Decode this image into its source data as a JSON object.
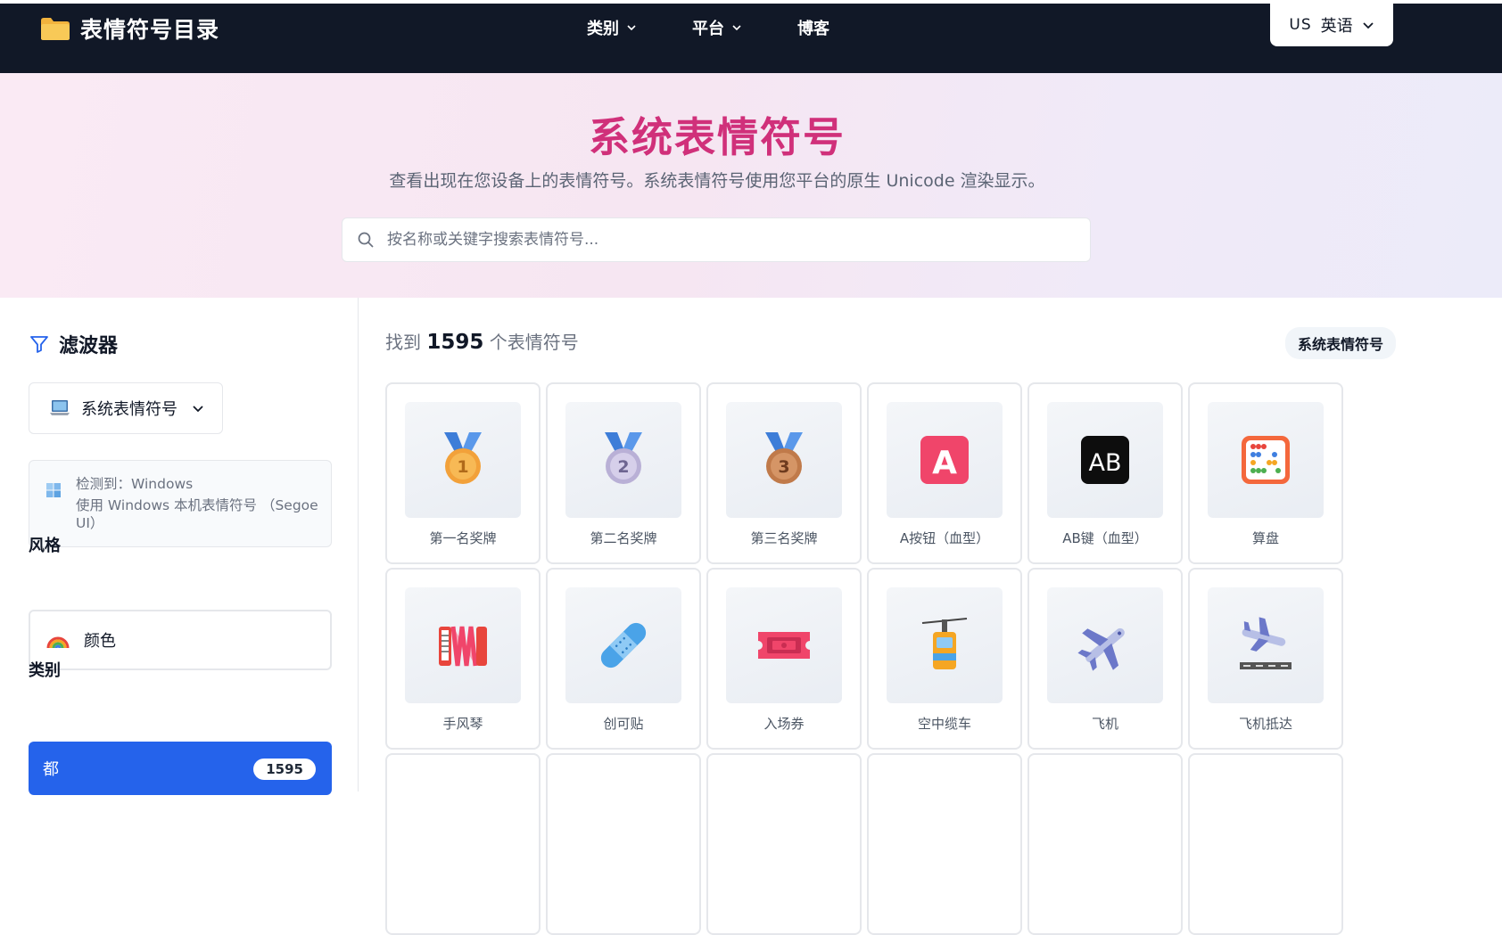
{
  "nav": {
    "brand": "表情符号目录",
    "menu": [
      {
        "label": "类别",
        "has_dropdown": true
      },
      {
        "label": "平台",
        "has_dropdown": true
      },
      {
        "label": "博客",
        "has_dropdown": false
      }
    ],
    "language": {
      "flag": "US",
      "label": "英语"
    }
  },
  "hero": {
    "title": "系统表情符号",
    "subtitle": "查看出现在您设备上的表情符号。系统表情符号使用您平台的原生 Unicode 渲染显示。",
    "search_placeholder": "按名称或关键字搜索表情符号..."
  },
  "sidebar": {
    "filter_title": "滤波器",
    "platform_select": "系统表情符号",
    "detected_line1": "检测到：Windows",
    "detected_line2": "使用 Windows 本机表情符号 （Segoe UI）",
    "style_label": "风格",
    "style_value": "颜色",
    "category_label": "类别",
    "category_all": {
      "label": "都",
      "count": "1595"
    }
  },
  "results": {
    "prefix": "找到",
    "count": "1595",
    "suffix": "个表情符号",
    "tag": "系统表情符号"
  },
  "emojis": [
    {
      "name": "第一名奖牌",
      "icon": "gold-medal-icon"
    },
    {
      "name": "第二名奖牌",
      "icon": "silver-medal-icon"
    },
    {
      "name": "第三名奖牌",
      "icon": "bronze-medal-icon"
    },
    {
      "name": "A按钮（血型）",
      "icon": "a-button-icon"
    },
    {
      "name": "AB键（血型）",
      "icon": "ab-button-icon"
    },
    {
      "name": "算盘",
      "icon": "abacus-icon"
    },
    {
      "name": "手风琴",
      "icon": "accordion-icon"
    },
    {
      "name": "创可贴",
      "icon": "adhesive-bandage-icon"
    },
    {
      "name": "入场券",
      "icon": "admission-ticket-icon"
    },
    {
      "name": "空中缆车",
      "icon": "aerial-tramway-icon"
    },
    {
      "name": "飞机",
      "icon": "airplane-icon"
    },
    {
      "name": "飞机抵达",
      "icon": "airplane-arrival-icon"
    }
  ],
  "colors": {
    "nav_bg": "#111827",
    "hero_title": "#d0307a",
    "accent": "#2563eb"
  }
}
